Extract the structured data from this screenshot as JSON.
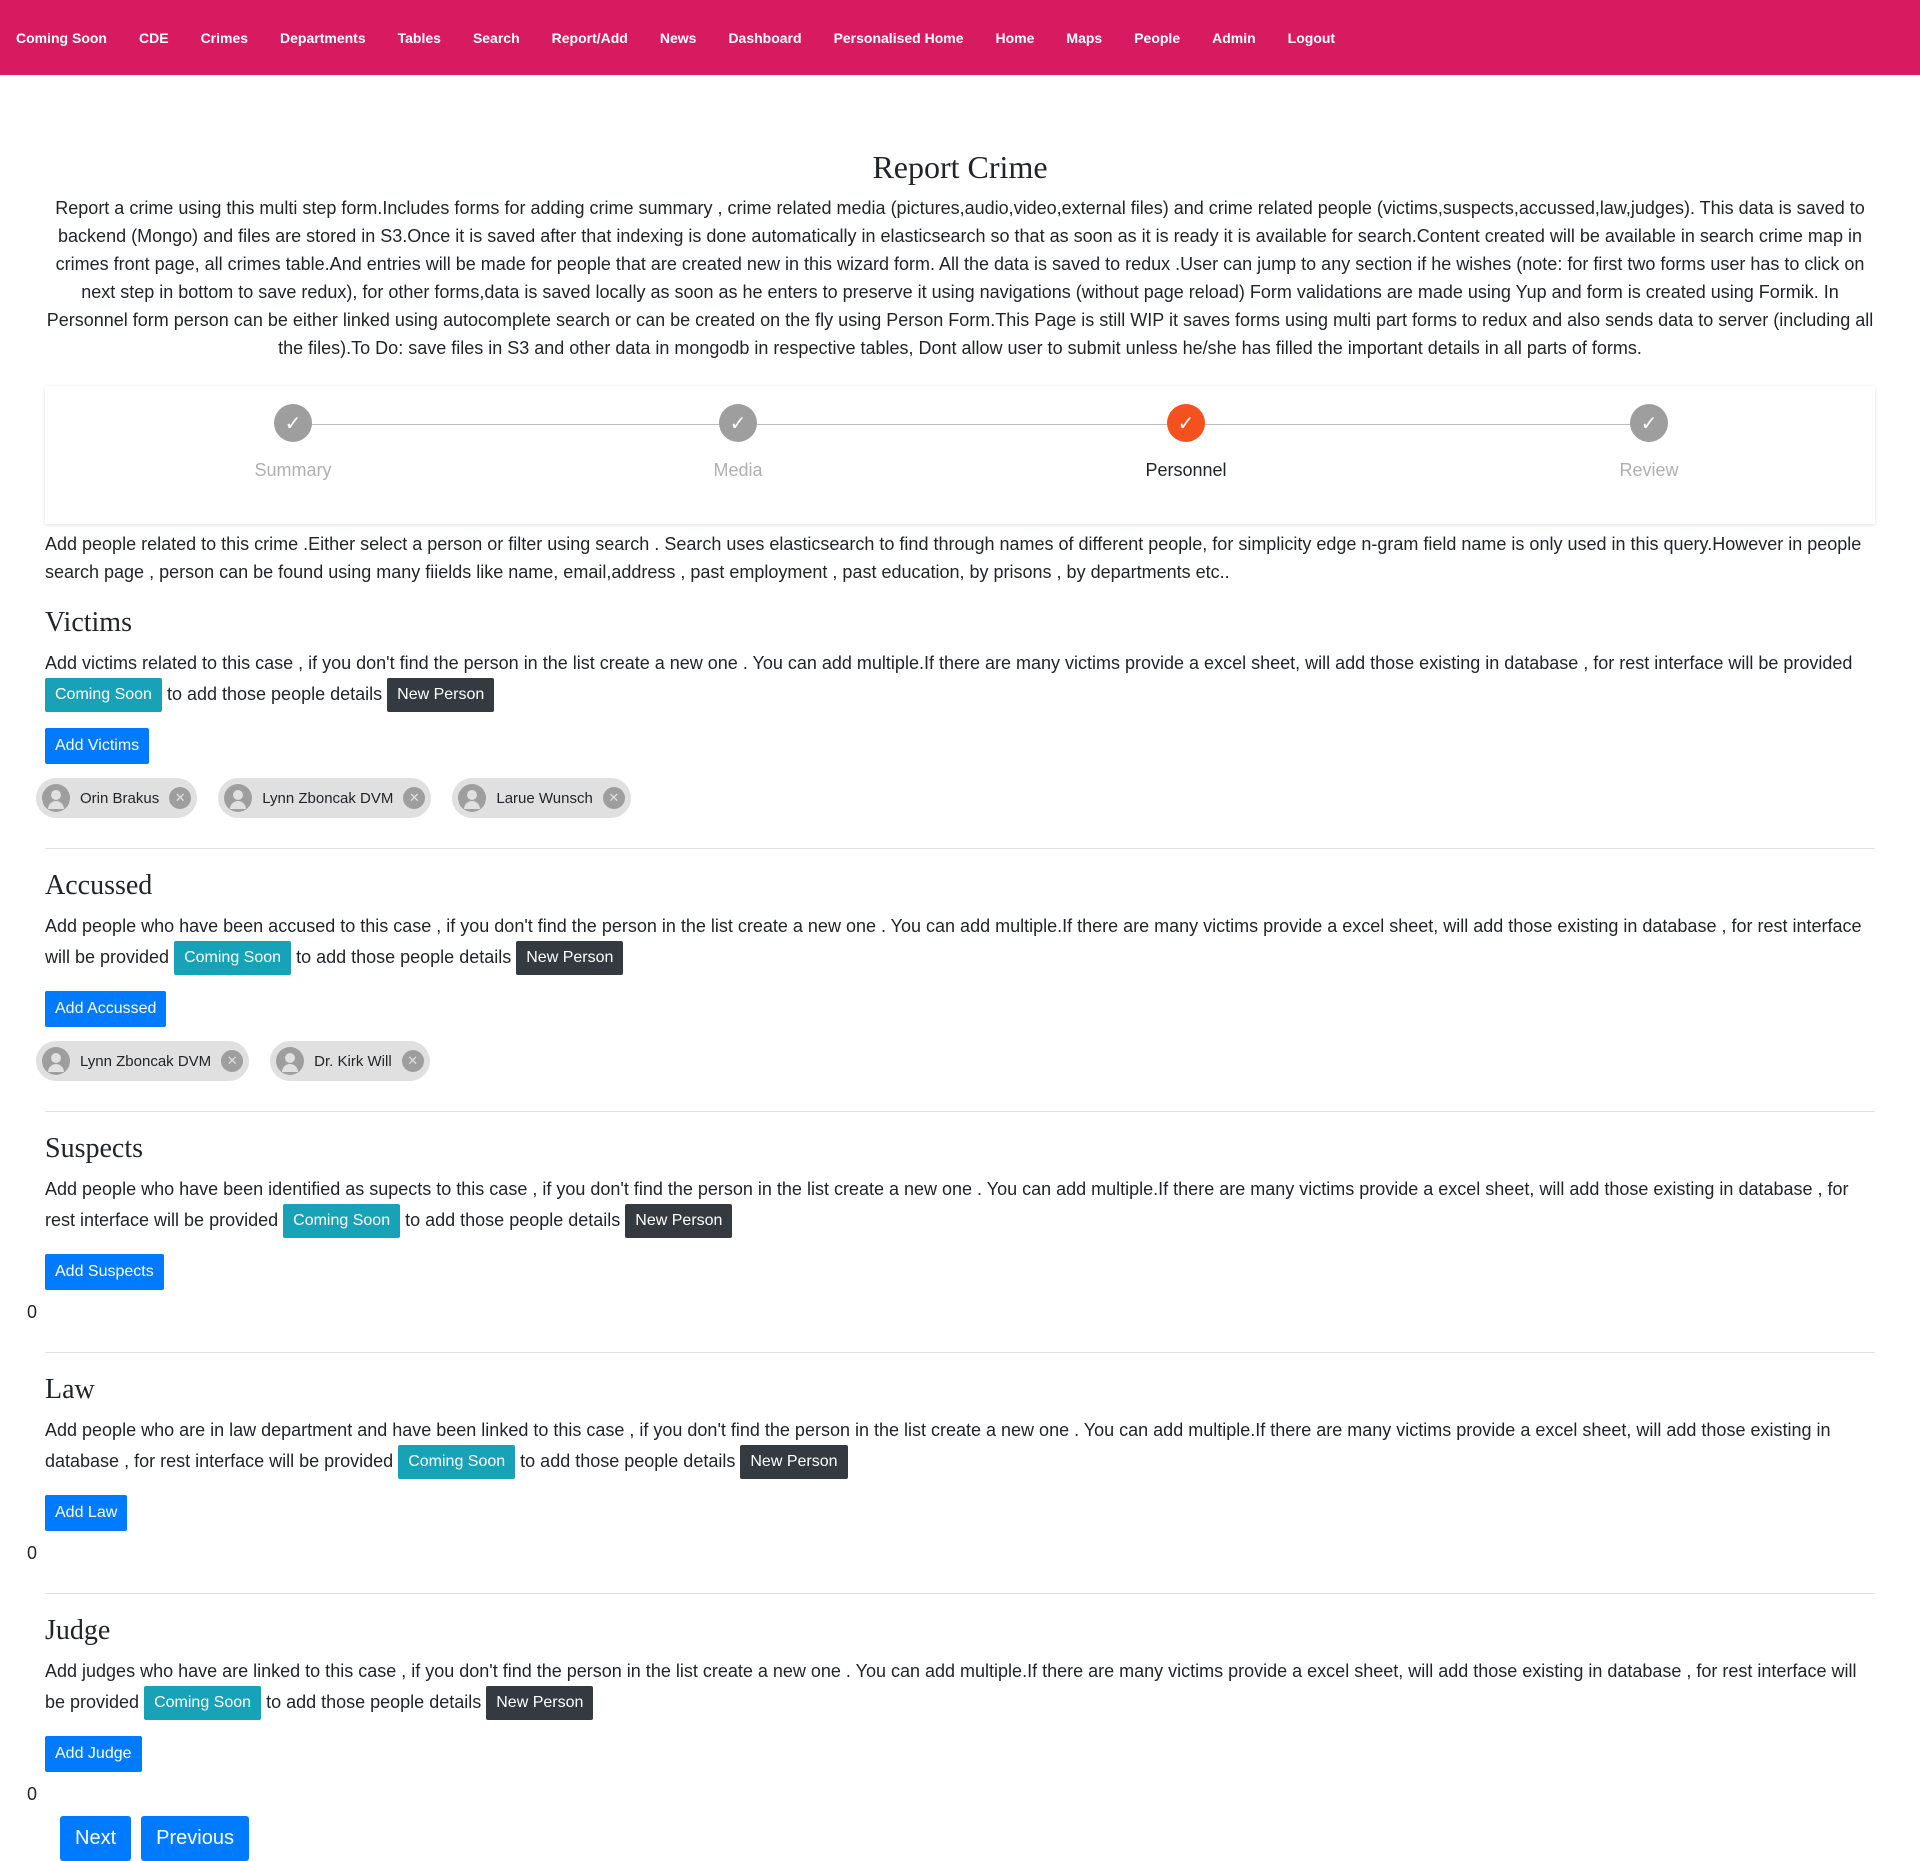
{
  "nav": {
    "items": [
      "Coming Soon",
      "CDE",
      "Crimes",
      "Departments",
      "Tables",
      "Search",
      "Report/Add",
      "News",
      "Dashboard",
      "Personalised Home",
      "Home",
      "Maps",
      "People",
      "Admin",
      "Logout"
    ]
  },
  "page": {
    "title": "Report Crime",
    "intro": "Report a crime using this multi step form.Includes forms for adding crime summary , crime related media (pictures,audio,video,external files) and crime related people (victims,suspects,accussed,law,judges). This data is saved to backend (Mongo) and files are stored in S3.Once it is saved after that indexing is done automatically in elasticsearch so that as soon as it is ready it is available for search.Content created will be available in search crime map in crimes front page, all crimes table.And entries will be made for people that are created new in this wizard form. All the data is saved to redux .User can jump to any section if he wishes (note: for first two forms user has to click on next step in bottom to save redux), for other forms,data is saved locally as soon as he enters to preserve it using navigations (without page reload) Form validations are made using Yup and form is created using Formik. In Personnel form person can be either linked using autocomplete search or can be created on the fly using Person Form.This Page is still WIP it saves forms using multi part forms to redux and also sends data to server (including all the files).To Do: save files in S3 and other data in mongodb in respective tables, Dont allow user to submit unless he/she has filled the important details in all parts of forms."
  },
  "stepper": {
    "steps": [
      {
        "label": "Summary",
        "icon": "check-icon",
        "active": false
      },
      {
        "label": "Media",
        "icon": "check-icon",
        "active": false
      },
      {
        "label": "Personnel",
        "icon": "check-icon",
        "active": true
      },
      {
        "label": "Review",
        "icon": "check-icon",
        "active": false
      }
    ],
    "active_color": "#f4511e",
    "inactive_color": "#9e9e9e"
  },
  "personnel": {
    "description": "Add people related to this crime .Either select a person or filter using search . Search uses elasticsearch to find through names of different people, for simplicity edge n-gram field name is only used in this query.However in people search page , person can be found using many fiields like name, email,address , past employment , past education, by prisons , by departments etc..",
    "coming_soon_label": "Coming Soon",
    "new_person_label": "New Person",
    "details_text": "to add those people details",
    "sections": {
      "victims": {
        "title": "Victims",
        "desc": "Add victims related to this case , if you don't find the person in the list create a new one . You can add multiple.If there are many victims provide a excel sheet, will add those existing in database , for rest interface will be provided",
        "add_label": "Add Victims",
        "people": [
          "Orin Brakus",
          "Lynn Zboncak DVM",
          "Larue Wunsch"
        ]
      },
      "accussed": {
        "title": "Accussed",
        "desc": "Add people who have been accused to this case , if you don't find the person in the list create a new one . You can add multiple.If there are many victims provide a excel sheet, will add those existing in database , for rest interface will be provided",
        "add_label": "Add Accussed",
        "people": [
          "Lynn Zboncak DVM",
          "Dr. Kirk Will"
        ]
      },
      "suspects": {
        "title": "Suspects",
        "desc": "Add people who have been identified as supects to this case , if you don't find the person in the list create a new one . You can add multiple.If there are many victims provide a excel sheet, will add those existing in database , for rest interface will be provided",
        "add_label": "Add Suspects",
        "count": "0"
      },
      "law": {
        "title": "Law",
        "desc": "Add people who are in law department and have been linked to this case , if you don't find the person in the list create a new one . You can add multiple.If there are many victims provide a excel sheet, will add those existing in database , for rest interface will be provided",
        "add_label": "Add Law",
        "count": "0"
      },
      "judge": {
        "title": "Judge",
        "desc": "Add judges who have are linked to this case , if you don't find the person in the list create a new one . You can add multiple.If there are many victims provide a excel sheet, will add those existing in database , for rest interface will be provided",
        "add_label": "Add Judge",
        "count": "0"
      }
    }
  },
  "footer": {
    "next_label": "Next",
    "previous_label": "Previous"
  },
  "colors": {
    "nav_bg": "#d81b60",
    "primary": "#007bff",
    "info": "#17a2b8",
    "dark": "#343a40"
  }
}
